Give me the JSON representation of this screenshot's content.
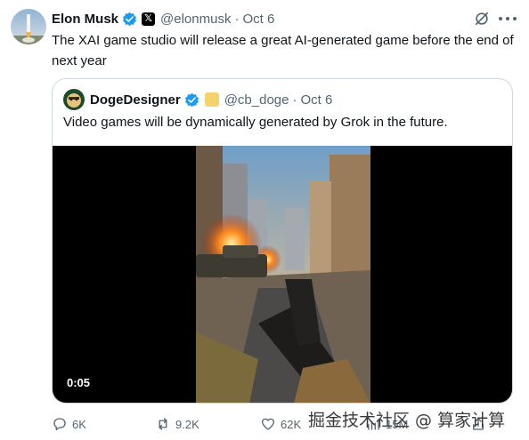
{
  "author": {
    "name": "Elon Musk",
    "handle": "@elonmusk",
    "separator": "·",
    "date": "Oct 6"
  },
  "tweet": {
    "text": "The XAI game studio will release a great AI-generated game before the end of next year"
  },
  "quote": {
    "name": "DogeDesigner",
    "handle": "@cb_doge",
    "separator": "·",
    "date": "Oct 6",
    "text": "Video games will be dynamically generated by Grok in the future.",
    "video_time": "0:05"
  },
  "actions": {
    "replies": "6K",
    "reposts": "9.2K",
    "likes": "62K",
    "views": "15M"
  },
  "watermark": "掘金技术社区 @ 算家计算",
  "colors": {
    "verified": "#1d9bf0",
    "muted": "#536471",
    "border": "#cfd9de"
  }
}
